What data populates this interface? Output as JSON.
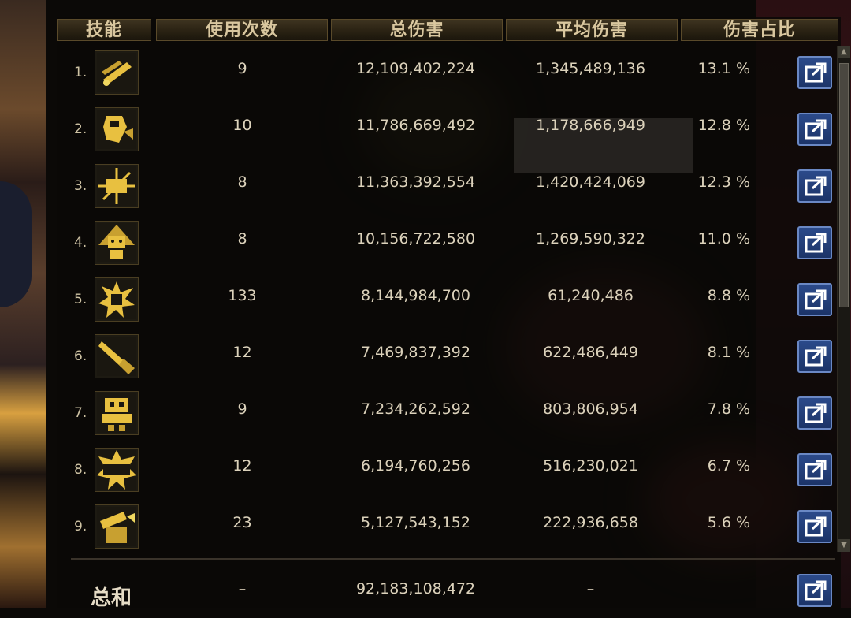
{
  "header": {
    "skill": "技能",
    "uses": "使用次数",
    "total_damage": "总伤害",
    "avg_damage": "平均伤害",
    "damage_ratio": "伤害占比"
  },
  "rows": [
    {
      "index": "1.",
      "icon": "missile-launch-icon",
      "uses": "9",
      "total": "12,109,402,224",
      "avg": "1,345,489,136",
      "pct": "13.1 %"
    },
    {
      "index": "2.",
      "icon": "robot-punch-icon",
      "uses": "10",
      "total": "11,786,669,492",
      "avg": "1,178,666,949",
      "pct": "12.8 %"
    },
    {
      "index": "3.",
      "icon": "laser-burst-icon",
      "uses": "8",
      "total": "11,363,392,554",
      "avg": "1,420,424,069",
      "pct": "12.3 %"
    },
    {
      "index": "4.",
      "icon": "robot-summon-icon",
      "uses": "8",
      "total": "10,156,722,580",
      "avg": "1,269,590,322",
      "pct": "11.0 %"
    },
    {
      "index": "5.",
      "icon": "explosion-bot-icon",
      "uses": "133",
      "total": "8,144,984,700",
      "avg": "61,240,486",
      "pct": "8.8 %"
    },
    {
      "index": "6.",
      "icon": "rocket-strike-icon",
      "uses": "12",
      "total": "7,469,837,392",
      "avg": "622,486,449",
      "pct": "8.1 %"
    },
    {
      "index": "7.",
      "icon": "mech-unit-icon",
      "uses": "9",
      "total": "7,234,262,592",
      "avg": "803,806,954",
      "pct": "7.8 %"
    },
    {
      "index": "8.",
      "icon": "timer-bomb-icon",
      "uses": "12",
      "total": "6,194,760,256",
      "avg": "516,230,021",
      "pct": "6.7 %"
    },
    {
      "index": "9.",
      "icon": "drill-cannon-icon",
      "uses": "23",
      "total": "5,127,543,152",
      "avg": "222,936,658",
      "pct": "5.6 %"
    }
  ],
  "summary": {
    "label": "总和",
    "uses": "–",
    "total": "92,183,108,472",
    "avg": "–"
  },
  "colors": {
    "header_text": "#d9c79f",
    "cell_text": "#dcd2bb",
    "share_button": "#2b4a8a",
    "icon_gold": "#e8c040"
  }
}
